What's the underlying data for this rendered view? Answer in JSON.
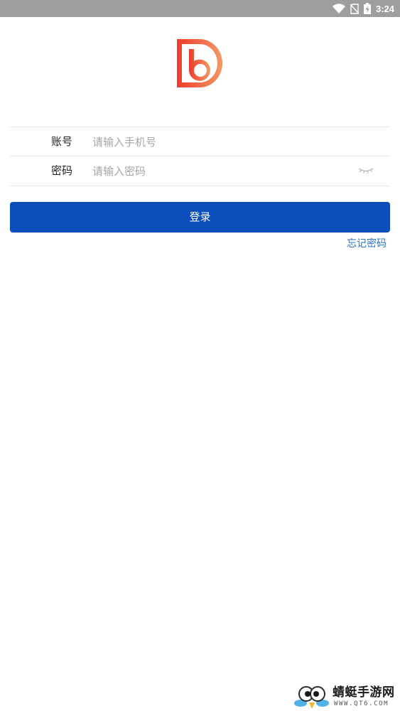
{
  "status_bar": {
    "time": "3:24",
    "icons": [
      "wifi-icon",
      "no-sim-icon",
      "battery-charging-icon"
    ]
  },
  "colors": {
    "status_bar": "#9e9e9e",
    "primary_button": "#0a4dbb",
    "link": "#2f72c7",
    "logo_gradient_start": "#ef3a2c",
    "logo_gradient_end": "#f39a65"
  },
  "form": {
    "account": {
      "label": "账号",
      "placeholder": "请输入手机号",
      "value": ""
    },
    "password": {
      "label": "密码",
      "placeholder": "请输入密码",
      "value": "",
      "toggle_icon": "eye-closed-icon"
    }
  },
  "actions": {
    "login_label": "登录",
    "forgot_label": "忘记密码"
  },
  "watermark": {
    "title": "蜻蜓手游网",
    "url": "WWW.QT6.COM"
  }
}
